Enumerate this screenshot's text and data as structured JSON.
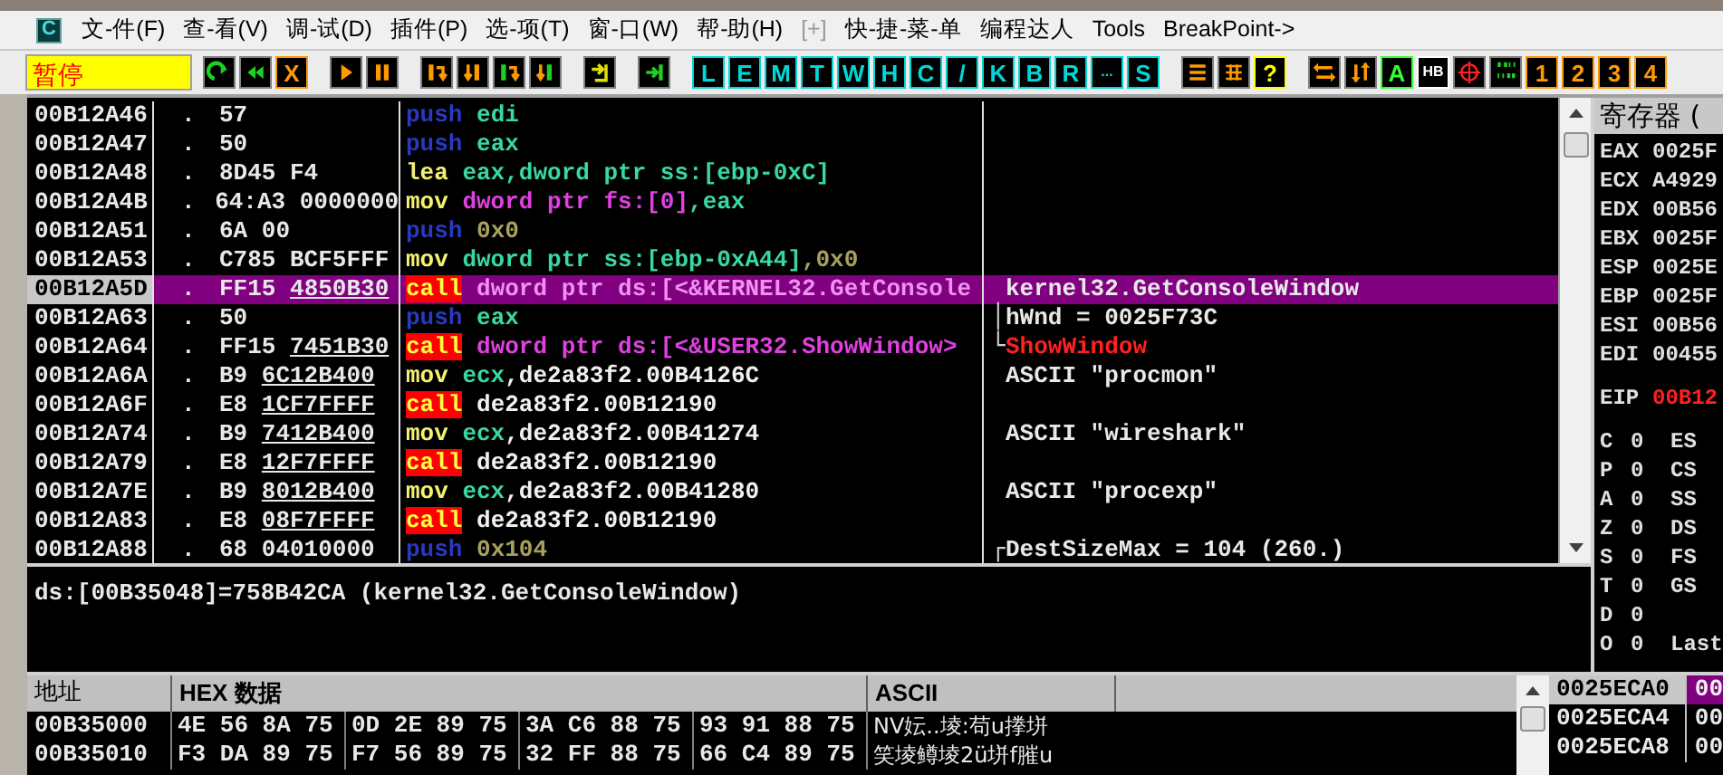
{
  "menu": {
    "items": [
      "文-件(F)",
      "查-看(V)",
      "调-试(D)",
      "插件(P)",
      "选-项(T)",
      "窗-口(W)",
      "帮-助(H)",
      "[+]",
      "快-捷-菜-单",
      "编程达人",
      "Tools",
      "BreakPoint->"
    ],
    "app_letter": "C"
  },
  "toolbar": {
    "status": "暂停",
    "groups": [
      [
        {
          "kind": "icon"
        },
        {
          "kind": "icon"
        },
        {
          "kind": "glyph",
          "label": "X",
          "color": "#ff9900"
        }
      ],
      [
        {
          "kind": "icon"
        },
        {
          "kind": "icon"
        }
      ],
      [
        {
          "kind": "icon"
        },
        {
          "kind": "icon"
        },
        {
          "kind": "icon"
        },
        {
          "kind": "icon"
        }
      ],
      [
        {
          "kind": "icon"
        }
      ],
      [
        {
          "kind": "icon"
        }
      ],
      [
        {
          "kind": "glyph",
          "label": "L",
          "color": "#00d8d8"
        },
        {
          "kind": "glyph",
          "label": "E",
          "color": "#00d8d8"
        },
        {
          "kind": "glyph",
          "label": "M",
          "color": "#00d8d8"
        },
        {
          "kind": "glyph",
          "label": "T",
          "color": "#00d8d8"
        },
        {
          "kind": "glyph",
          "label": "W",
          "color": "#00d8d8"
        },
        {
          "kind": "glyph",
          "label": "H",
          "color": "#00d8d8"
        },
        {
          "kind": "glyph",
          "label": "C",
          "color": "#00d8d8"
        },
        {
          "kind": "glyph",
          "label": "/",
          "color": "#00d8d8"
        },
        {
          "kind": "glyph",
          "label": "K",
          "color": "#00d8d8"
        },
        {
          "kind": "glyph",
          "label": "B",
          "color": "#00d8d8"
        },
        {
          "kind": "glyph",
          "label": "R",
          "color": "#00d8d8"
        },
        {
          "kind": "glyph",
          "label": "...",
          "color": "#00d8d8"
        },
        {
          "kind": "glyph",
          "label": "S",
          "color": "#00d8d8"
        }
      ],
      [
        {
          "kind": "icon"
        },
        {
          "kind": "icon"
        },
        {
          "kind": "glyph",
          "label": "?",
          "color": "#ffff00"
        }
      ],
      [
        {
          "kind": "icon"
        },
        {
          "kind": "icon"
        },
        {
          "kind": "glyph",
          "label": "A",
          "color": "#33ff33"
        },
        {
          "kind": "glyph",
          "label": "HB",
          "color": "#ffffff"
        },
        {
          "kind": "icon"
        },
        {
          "kind": "icon"
        },
        {
          "kind": "glyph",
          "label": "1",
          "color": "#ff9900"
        },
        {
          "kind": "glyph",
          "label": "2",
          "color": "#ff9900"
        },
        {
          "kind": "glyph",
          "label": "3",
          "color": "#ff9900"
        },
        {
          "kind": "glyph",
          "label": "4",
          "color": "#ff9900"
        }
      ]
    ]
  },
  "disassembly": {
    "rows": [
      {
        "address": "00B12A46",
        "marker": ".",
        "hex": "57",
        "asm": [
          {
            "text": "push",
            "kind": "push"
          },
          {
            "text": " edi",
            "kind": "reg"
          }
        ],
        "selected": false
      },
      {
        "address": "00B12A47",
        "marker": ".",
        "hex": "50",
        "asm": [
          {
            "text": "push",
            "kind": "push"
          },
          {
            "text": " eax",
            "kind": "reg"
          }
        ],
        "selected": false
      },
      {
        "address": "00B12A48",
        "marker": ".",
        "hex": "8D45 F4",
        "asm": [
          {
            "text": "lea",
            "kind": "mov"
          },
          {
            "text": " eax,dword ptr ss:[ebp-0xC]",
            "kind": "reg"
          }
        ],
        "selected": false
      },
      {
        "address": "00B12A4B",
        "marker": ".",
        "hex": "64:A3 0000000",
        "asm": [
          {
            "text": "mov",
            "kind": "mov"
          },
          {
            "text": " dword ptr fs:[0]",
            "kind": "mem"
          },
          {
            "text": ",eax",
            "kind": "reg"
          }
        ],
        "selected": false
      },
      {
        "address": "00B12A51",
        "marker": ".",
        "hex": "6A 00",
        "asm": [
          {
            "text": "push",
            "kind": "push"
          },
          {
            "text": " 0x0",
            "kind": "const"
          }
        ],
        "selected": false
      },
      {
        "address": "00B12A53",
        "marker": ".",
        "hex": "C785 BCF5FFF",
        "asm": [
          {
            "text": "mov",
            "kind": "mov"
          },
          {
            "text": " dword ptr ss:[ebp-0xA44]",
            "kind": "reg"
          },
          {
            "text": ",0x0",
            "kind": "const"
          }
        ],
        "selected": false
      },
      {
        "address": "00B12A5D",
        "marker": ".",
        "hex": "FF15",
        "hex_link": "4850B30",
        "asm": [
          {
            "text": "call",
            "kind": "call"
          },
          {
            "text": " dword ptr ds:[<&KERNEL32.GetConsole",
            "kind": "mem"
          }
        ],
        "comment": {
          "text": "kernel32.GetConsoleWindow",
          "kind": "plain"
        },
        "selected": true
      },
      {
        "address": "00B12A63",
        "marker": ".",
        "hex": "50",
        "asm": [
          {
            "text": "push",
            "kind": "push"
          },
          {
            "text": " eax",
            "kind": "reg"
          }
        ],
        "comment": {
          "text": "hWnd = 0025F73C",
          "kind": "plain",
          "bracket": "│"
        },
        "selected": false
      },
      {
        "address": "00B12A64",
        "marker": ".",
        "hex": "FF15",
        "hex_link": "7451B30",
        "asm": [
          {
            "text": "call",
            "kind": "call"
          },
          {
            "text": " dword ptr ds:[<&USER32.ShowWindow>",
            "kind": "mem"
          }
        ],
        "comment": {
          "text": "ShowWindow",
          "kind": "api",
          "bracket": "└"
        },
        "selected": false
      },
      {
        "address": "00B12A6A",
        "marker": ".",
        "hex": "B9",
        "hex_link": "6C12B400",
        "asm": [
          {
            "text": "mov",
            "kind": "mov"
          },
          {
            "text": " ecx",
            "kind": "reg"
          },
          {
            "text": ",de2a83f2.00B4126C",
            "kind": "plain"
          }
        ],
        "comment": {
          "text": "ASCII \"procmon\"",
          "kind": "plain"
        },
        "selected": false
      },
      {
        "address": "00B12A6F",
        "marker": ".",
        "hex": "E8",
        "hex_link": "1CF7FFFF",
        "asm": [
          {
            "text": "call",
            "kind": "call"
          },
          {
            "text": " de2a83f2.00B12190",
            "kind": "plain"
          }
        ],
        "selected": false
      },
      {
        "address": "00B12A74",
        "marker": ".",
        "hex": "B9",
        "hex_link": "7412B400",
        "asm": [
          {
            "text": "mov",
            "kind": "mov"
          },
          {
            "text": " ecx",
            "kind": "reg"
          },
          {
            "text": ",de2a83f2.00B41274",
            "kind": "plain"
          }
        ],
        "comment": {
          "text": "ASCII \"wireshark\"",
          "kind": "plain"
        },
        "selected": false
      },
      {
        "address": "00B12A79",
        "marker": ".",
        "hex": "E8",
        "hex_link": "12F7FFFF",
        "asm": [
          {
            "text": "call",
            "kind": "call"
          },
          {
            "text": " de2a83f2.00B12190",
            "kind": "plain"
          }
        ],
        "selected": false
      },
      {
        "address": "00B12A7E",
        "marker": ".",
        "hex": "B9",
        "hex_link": "8012B400",
        "asm": [
          {
            "text": "mov",
            "kind": "mov"
          },
          {
            "text": " ecx",
            "kind": "reg"
          },
          {
            "text": ",de2a83f2.00B41280",
            "kind": "plain"
          }
        ],
        "comment": {
          "text": "ASCII \"procexp\"",
          "kind": "plain"
        },
        "selected": false
      },
      {
        "address": "00B12A83",
        "marker": ".",
        "hex": "E8",
        "hex_link": "08F7FFFF",
        "asm": [
          {
            "text": "call",
            "kind": "call"
          },
          {
            "text": " de2a83f2.00B12190",
            "kind": "plain"
          }
        ],
        "selected": false
      },
      {
        "address": "00B12A88",
        "marker": ".",
        "hex": "68 04010000",
        "asm": [
          {
            "text": "push",
            "kind": "push"
          },
          {
            "text": " 0x104",
            "kind": "const"
          }
        ],
        "comment": {
          "text": "DestSizeMax = 104 (260.)",
          "kind": "plain",
          "bracket": "┌"
        },
        "selected": false
      }
    ]
  },
  "info": "ds:[00B35048]=758B42CA (kernel32.GetConsoleWindow)",
  "registers": {
    "title": "寄存器 (",
    "rows": [
      {
        "name": "EAX",
        "value": "0025F"
      },
      {
        "name": "ECX",
        "value": "A4929"
      },
      {
        "name": "EDX",
        "value": "00B56"
      },
      {
        "name": "EBX",
        "value": "0025F"
      },
      {
        "name": "ESP",
        "value": "0025E"
      },
      {
        "name": "EBP",
        "value": "0025F"
      },
      {
        "name": "ESI",
        "value": "00B56"
      },
      {
        "name": "EDI",
        "value": "00455"
      }
    ],
    "eip": {
      "name": "EIP",
      "value": "00B12"
    },
    "flags": [
      {
        "name": "C",
        "value": "0",
        "segment": "ES"
      },
      {
        "name": "P",
        "value": "0",
        "segment": "CS"
      },
      {
        "name": "A",
        "value": "0",
        "segment": "SS"
      },
      {
        "name": "Z",
        "value": "0",
        "segment": "DS"
      },
      {
        "name": "S",
        "value": "0",
        "segment": "FS"
      },
      {
        "name": "T",
        "value": "0",
        "segment": "GS"
      },
      {
        "name": "D",
        "value": "0"
      },
      {
        "name": "O",
        "value": "0",
        "segment": "Last"
      }
    ]
  },
  "dump": {
    "columns": [
      "地址",
      "HEX 数据",
      "ASCII"
    ],
    "rows": [
      {
        "address": "00B35000",
        "groups": [
          "4E 56 8A 75",
          "0D 2E 89 75",
          "3A C6 88 75",
          "93 91 88 75"
        ],
        "ascii": "NV妘..堎:苟u搼垪"
      },
      {
        "address": "00B35010",
        "groups": [
          "F3 DA 89 75",
          "F7 56 89 75",
          "32 FF 88 75",
          "66 C4 89 75"
        ],
        "ascii": "笑堎鳟堎2ü垪f膗u"
      }
    ]
  },
  "stack": {
    "rows": [
      {
        "address": "0025ECA0",
        "value": "00",
        "selected": true
      },
      {
        "address": "0025ECA4",
        "value": "00",
        "selected": false
      },
      {
        "address": "0025ECA8",
        "value": "00",
        "selected": false
      }
    ]
  }
}
